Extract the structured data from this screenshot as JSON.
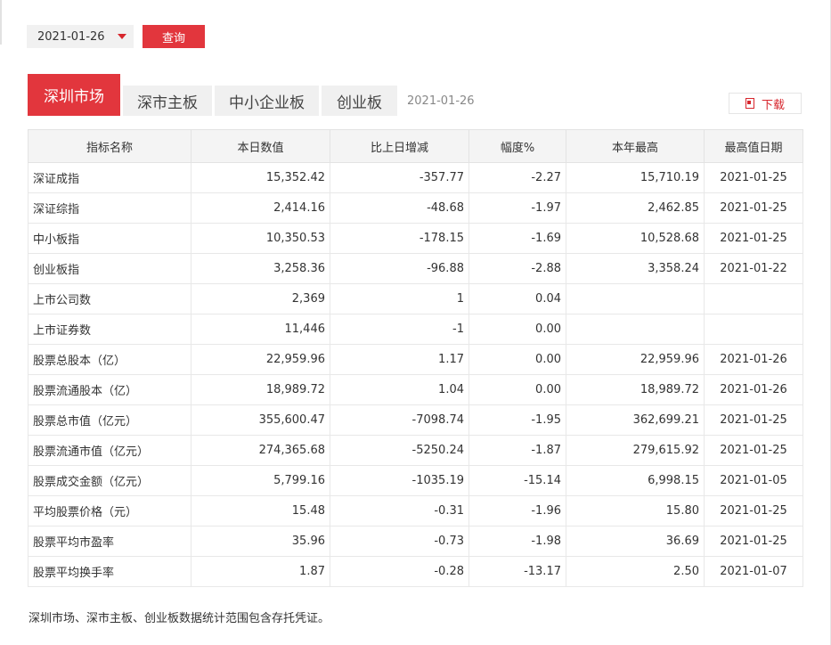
{
  "query": {
    "date_value": "2021-01-26",
    "button_label": "查询"
  },
  "tabs": [
    {
      "label": "深圳市场",
      "active": true
    },
    {
      "label": "深市主板",
      "active": false
    },
    {
      "label": "中小企业板",
      "active": false
    },
    {
      "label": "创业板",
      "active": false
    }
  ],
  "tabs_date": "2021-01-26",
  "download_label": "下载",
  "table": {
    "headers": [
      "指标名称",
      "本日数值",
      "比上日增减",
      "幅度%",
      "本年最高",
      "最高值日期"
    ],
    "rows": [
      [
        "深证成指",
        "15,352.42",
        "-357.77",
        "-2.27",
        "15,710.19",
        "2021-01-25"
      ],
      [
        "深证综指",
        "2,414.16",
        "-48.68",
        "-1.97",
        "2,462.85",
        "2021-01-25"
      ],
      [
        "中小板指",
        "10,350.53",
        "-178.15",
        "-1.69",
        "10,528.68",
        "2021-01-25"
      ],
      [
        "创业板指",
        "3,258.36",
        "-96.88",
        "-2.88",
        "3,358.24",
        "2021-01-22"
      ],
      [
        "上市公司数",
        "2,369",
        "1",
        "0.04",
        "",
        ""
      ],
      [
        "上市证券数",
        "11,446",
        "-1",
        "0.00",
        "",
        ""
      ],
      [
        "股票总股本（亿）",
        "22,959.96",
        "1.17",
        "0.00",
        "22,959.96",
        "2021-01-26"
      ],
      [
        "股票流通股本（亿）",
        "18,989.72",
        "1.04",
        "0.00",
        "18,989.72",
        "2021-01-26"
      ],
      [
        "股票总市值（亿元）",
        "355,600.47",
        "-7098.74",
        "-1.95",
        "362,699.21",
        "2021-01-25"
      ],
      [
        "股票流通市值（亿元）",
        "274,365.68",
        "-5250.24",
        "-1.87",
        "279,615.92",
        "2021-01-25"
      ],
      [
        "股票成交金额（亿元）",
        "5,799.16",
        "-1035.19",
        "-15.14",
        "6,998.15",
        "2021-01-05"
      ],
      [
        "平均股票价格（元）",
        "15.48",
        "-0.31",
        "-1.96",
        "15.80",
        "2021-01-25"
      ],
      [
        "股票平均市盈率",
        "35.96",
        "-0.73",
        "-1.98",
        "36.69",
        "2021-01-25"
      ],
      [
        "股票平均换手率",
        "1.87",
        "-0.28",
        "-13.17",
        "2.50",
        "2021-01-07"
      ]
    ]
  },
  "footnote": "深圳市场、深市主板、创业板数据统计范围包含存托凭证。",
  "colors": {
    "accent": "#e2363d",
    "header_bg": "#f4f4f4",
    "tab_bg": "#f0f0f0"
  }
}
